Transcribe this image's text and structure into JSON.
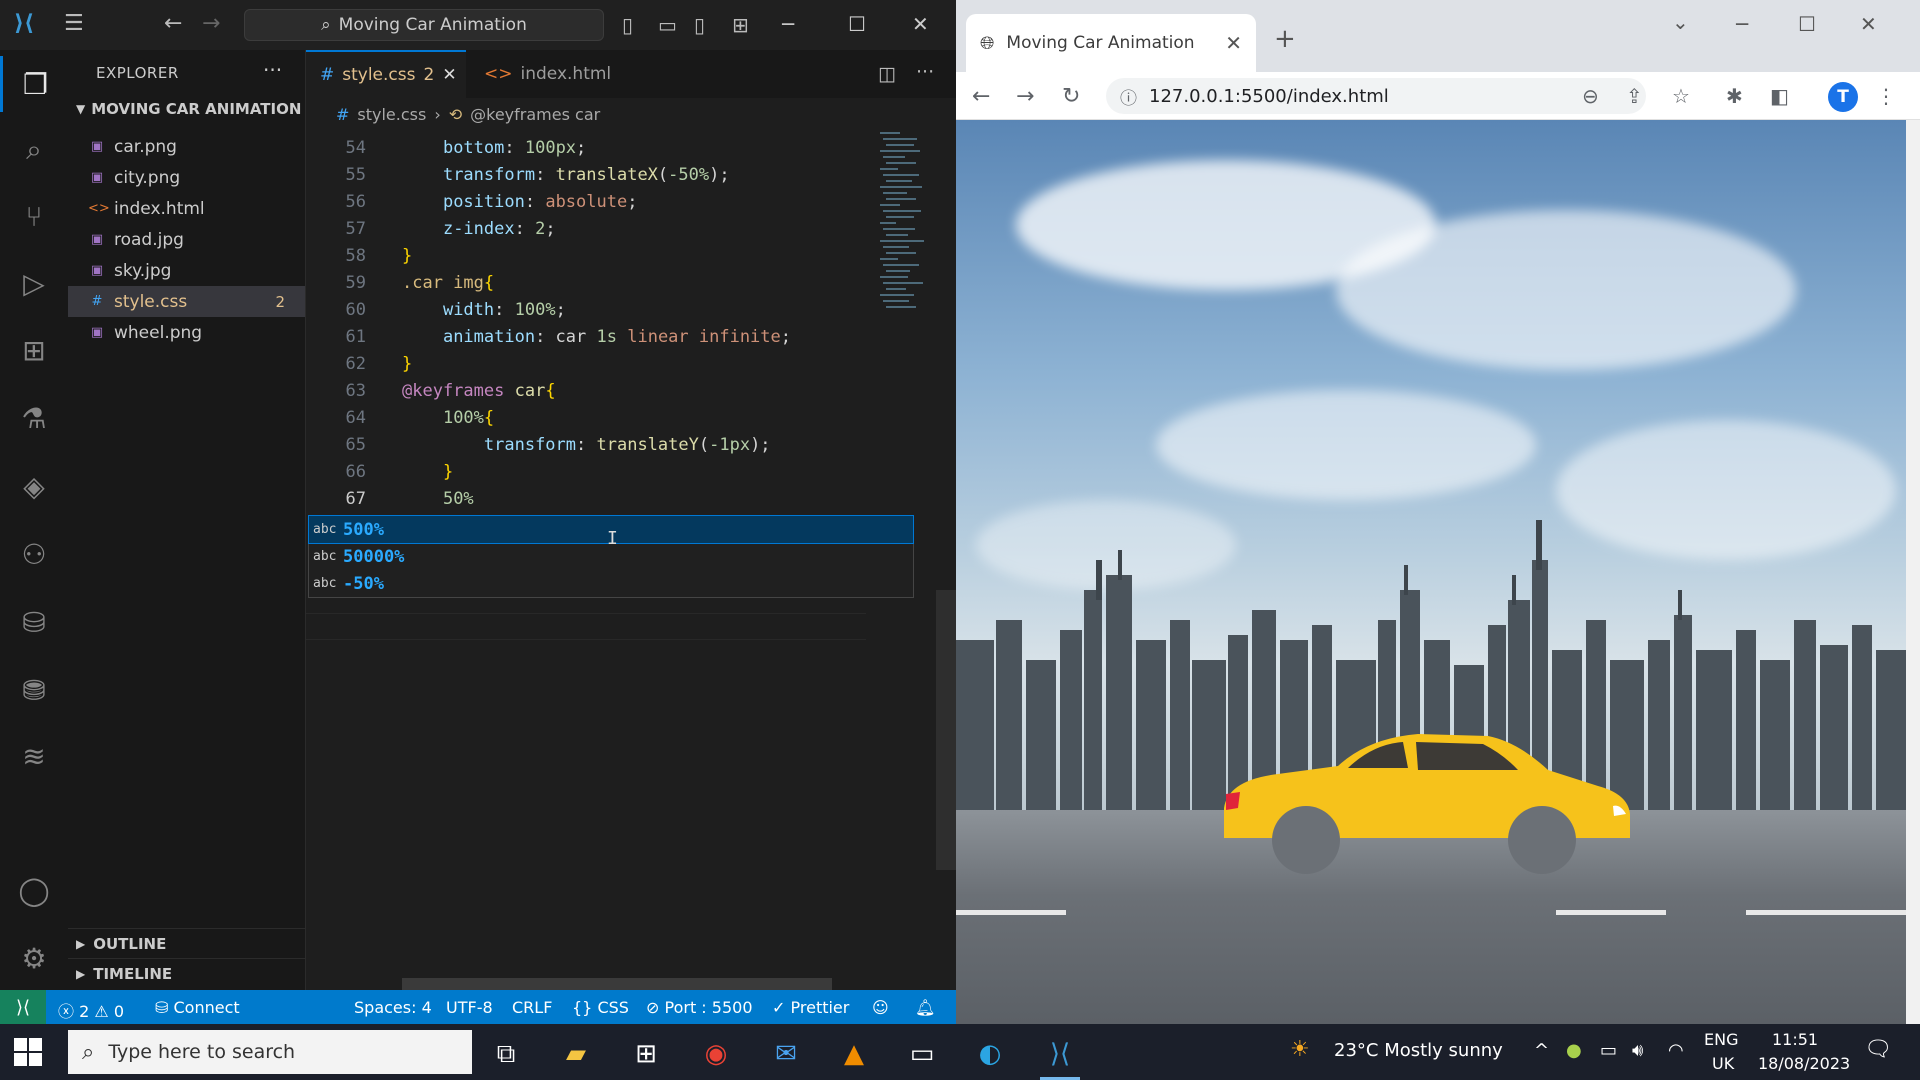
{
  "vscode": {
    "command_center": "Moving Car Animation",
    "explorer": {
      "title": "EXPLORER",
      "folder": "MOVING CAR ANIMATION",
      "files": [
        {
          "name": "car.png",
          "type": "image"
        },
        {
          "name": "city.png",
          "type": "image"
        },
        {
          "name": "index.html",
          "type": "html"
        },
        {
          "name": "road.jpg",
          "type": "image"
        },
        {
          "name": "sky.jpg",
          "type": "image"
        },
        {
          "name": "style.css",
          "type": "css",
          "badge": "2",
          "selected": true
        },
        {
          "name": "wheel.png",
          "type": "image"
        }
      ],
      "outline": "OUTLINE",
      "timeline": "TIMELINE"
    },
    "tabs": [
      {
        "label": "style.css",
        "badge": "2",
        "active": true
      },
      {
        "label": "index.html",
        "active": false
      }
    ],
    "breadcrumb": [
      "style.css",
      "@keyframes car"
    ],
    "code_lines": [
      {
        "n": "54",
        "text": "    bottom: 100px;"
      },
      {
        "n": "55",
        "text": "    transform: translateX(-50%);"
      },
      {
        "n": "56",
        "text": "    position: absolute;"
      },
      {
        "n": "57",
        "text": "    z-index: 2;"
      },
      {
        "n": "58",
        "text": "}"
      },
      {
        "n": "59",
        "text": ".car img{"
      },
      {
        "n": "60",
        "text": "    width: 100%;"
      },
      {
        "n": "61",
        "text": "    animation: car 1s linear infinite;"
      },
      {
        "n": "62",
        "text": "}"
      },
      {
        "n": "63",
        "text": "@keyframes car{"
      },
      {
        "n": "64",
        "text": "    100%{"
      },
      {
        "n": "65",
        "text": "        transform: translateY(-1px);"
      },
      {
        "n": "66",
        "text": "    }"
      },
      {
        "n": "67",
        "text": "    50%"
      }
    ],
    "suggestions": [
      {
        "kind": "abc",
        "label": "500%",
        "selected": true
      },
      {
        "kind": "abc",
        "label": "50000%"
      },
      {
        "kind": "abc",
        "label": "-50%"
      }
    ],
    "status": {
      "errors": "2",
      "warnings": "0",
      "connect": "Connect",
      "spaces": "Spaces: 4",
      "encoding": "UTF-8",
      "eol": "CRLF",
      "language": "CSS",
      "port": "Port : 5500",
      "prettier": "Prettier"
    }
  },
  "browser": {
    "tab_title": "Moving Car Animation",
    "url": "127.0.0.1:5500/index.html",
    "profile_initial": "T"
  },
  "taskbar": {
    "search_placeholder": "Type here to search",
    "weather": "23°C  Mostly sunny",
    "lang": "ENG",
    "region": "UK",
    "time": "11:51",
    "date": "18/08/2023"
  },
  "colors": {
    "accent": "#007acc",
    "remote": "#16825d",
    "car": "#f6c21b"
  }
}
